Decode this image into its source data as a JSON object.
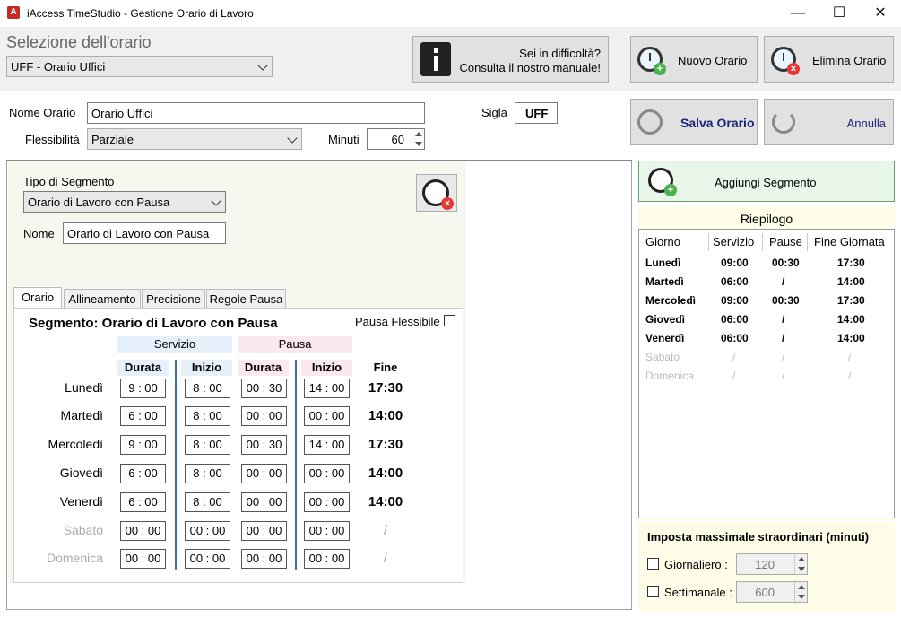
{
  "window": {
    "title": "iAccess TimeStudio - Gestione Orario di Lavoro",
    "app_icon_letter": "A",
    "minimize": "—",
    "maximize": "☐",
    "close": "✕"
  },
  "header": {
    "section_title": "Selezione dell'orario",
    "selected_schedule": "UFF - Orario Uffici",
    "help_line1": "Sei in difficoltà?",
    "help_line2": "Consulta il nostro manuale!",
    "new_label": "Nuovo Orario",
    "delete_label": "Elimina Orario",
    "save_label": "Salva Orario",
    "cancel_label": "Annulla"
  },
  "form": {
    "name_label": "Nome Orario",
    "name_value": "Orario Uffici",
    "sigla_label": "Sigla",
    "sigla_value": "UFF",
    "flex_label": "Flessibilità",
    "flex_value": "Parziale",
    "minutes_label": "Minuti",
    "minutes_value": "60"
  },
  "segment": {
    "type_label": "Tipo di Segmento",
    "type_value": "Orario di Lavoro con Pausa",
    "name_label": "Nome",
    "name_value": "Orario di Lavoro con Pausa",
    "tabs": [
      "Orario",
      "Allineamento",
      "Precisione",
      "Regole Pausa"
    ],
    "heading": "Segmento: Orario di Lavoro con Pausa",
    "pausa_flessibile": "Pausa Flessibile",
    "group_servizio": "Servizio",
    "group_pausa": "Pausa",
    "col_durata": "Durata",
    "col_inizio": "Inizio",
    "col_fine": "Fine",
    "rows": [
      {
        "day": "Lunedì",
        "d": "9 : 00",
        "i": "8 : 00",
        "pd": "00 : 30",
        "pi": "14 : 00",
        "fine": "17:30",
        "active": true
      },
      {
        "day": "Martedì",
        "d": "6 : 00",
        "i": "8 : 00",
        "pd": "00 : 00",
        "pi": "00 : 00",
        "fine": "14:00",
        "active": true
      },
      {
        "day": "Mercoledì",
        "d": "9 : 00",
        "i": "8 : 00",
        "pd": "00 : 30",
        "pi": "14 : 00",
        "fine": "17:30",
        "active": true
      },
      {
        "day": "Giovedì",
        "d": "6 : 00",
        "i": "8 : 00",
        "pd": "00 : 00",
        "pi": "00 : 00",
        "fine": "14:00",
        "active": true
      },
      {
        "day": "Venerdì",
        "d": "6 : 00",
        "i": "8 : 00",
        "pd": "00 : 00",
        "pi": "00 : 00",
        "fine": "14:00",
        "active": true
      },
      {
        "day": "Sabato",
        "d": "00 : 00",
        "i": "00 : 00",
        "pd": "00 : 00",
        "pi": "00 : 00",
        "fine": "/",
        "active": false
      },
      {
        "day": "Domenica",
        "d": "00 : 00",
        "i": "00 : 00",
        "pd": "00 : 00",
        "pi": "00 : 00",
        "fine": "/",
        "active": false
      }
    ]
  },
  "right": {
    "add_segment": "Aggiungi Segmento",
    "summary_title": "Riepilogo",
    "headers": [
      "Giorno",
      "Servizio",
      "Pause",
      "Fine Giornata"
    ],
    "rows": [
      {
        "g": "Lunedì",
        "s": "09:00",
        "p": "00:30",
        "f": "17:30",
        "active": true
      },
      {
        "g": "Martedì",
        "s": "06:00",
        "p": "/",
        "f": "14:00",
        "active": true
      },
      {
        "g": "Mercoledì",
        "s": "09:00",
        "p": "00:30",
        "f": "17:30",
        "active": true
      },
      {
        "g": "Giovedì",
        "s": "06:00",
        "p": "/",
        "f": "14:00",
        "active": true
      },
      {
        "g": "Venerdì",
        "s": "06:00",
        "p": "/",
        "f": "14:00",
        "active": true
      },
      {
        "g": "Sabato",
        "s": "/",
        "p": "/",
        "f": "/",
        "active": false
      },
      {
        "g": "Domenica",
        "s": "/",
        "p": "/",
        "f": "/",
        "active": false
      }
    ],
    "overtime_title": "Imposta massimale straordinari (minuti)",
    "daily_label": "Giornaliero :",
    "daily_value": "120",
    "weekly_label": "Settimanale :",
    "weekly_value": "600"
  },
  "colors": {
    "servizio_bg": "#e6f0fb",
    "pausa_bg": "#fbe9ef",
    "separator": "#3a6ea5",
    "accent_blue": "#1a237e"
  }
}
